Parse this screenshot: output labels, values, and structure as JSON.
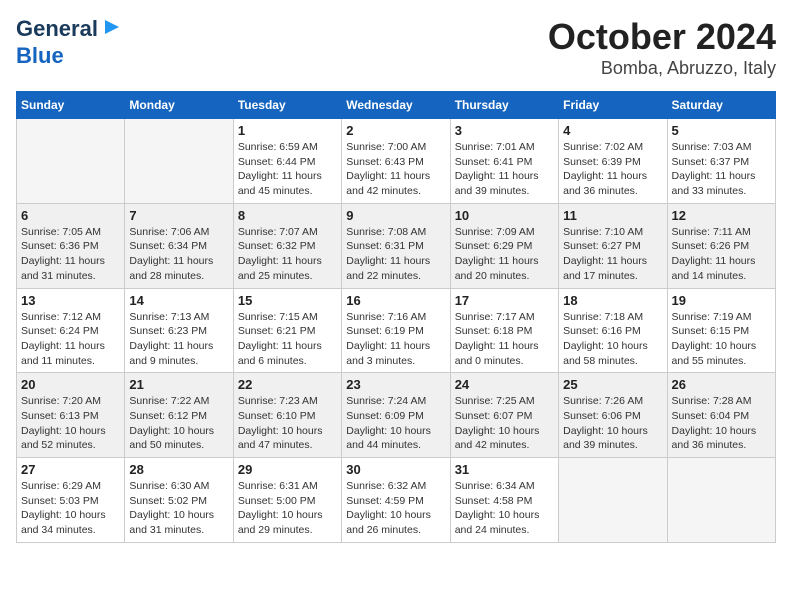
{
  "logo": {
    "line1": "General",
    "line2": "Blue"
  },
  "title": {
    "month": "October 2024",
    "location": "Bomba, Abruzzo, Italy"
  },
  "weekdays": [
    "Sunday",
    "Monday",
    "Tuesday",
    "Wednesday",
    "Thursday",
    "Friday",
    "Saturday"
  ],
  "weeks": [
    [
      {
        "day": "",
        "detail": ""
      },
      {
        "day": "",
        "detail": ""
      },
      {
        "day": "1",
        "detail": "Sunrise: 6:59 AM\nSunset: 6:44 PM\nDaylight: 11 hours and 45 minutes."
      },
      {
        "day": "2",
        "detail": "Sunrise: 7:00 AM\nSunset: 6:43 PM\nDaylight: 11 hours and 42 minutes."
      },
      {
        "day": "3",
        "detail": "Sunrise: 7:01 AM\nSunset: 6:41 PM\nDaylight: 11 hours and 39 minutes."
      },
      {
        "day": "4",
        "detail": "Sunrise: 7:02 AM\nSunset: 6:39 PM\nDaylight: 11 hours and 36 minutes."
      },
      {
        "day": "5",
        "detail": "Sunrise: 7:03 AM\nSunset: 6:37 PM\nDaylight: 11 hours and 33 minutes."
      }
    ],
    [
      {
        "day": "6",
        "detail": "Sunrise: 7:05 AM\nSunset: 6:36 PM\nDaylight: 11 hours and 31 minutes."
      },
      {
        "day": "7",
        "detail": "Sunrise: 7:06 AM\nSunset: 6:34 PM\nDaylight: 11 hours and 28 minutes."
      },
      {
        "day": "8",
        "detail": "Sunrise: 7:07 AM\nSunset: 6:32 PM\nDaylight: 11 hours and 25 minutes."
      },
      {
        "day": "9",
        "detail": "Sunrise: 7:08 AM\nSunset: 6:31 PM\nDaylight: 11 hours and 22 minutes."
      },
      {
        "day": "10",
        "detail": "Sunrise: 7:09 AM\nSunset: 6:29 PM\nDaylight: 11 hours and 20 minutes."
      },
      {
        "day": "11",
        "detail": "Sunrise: 7:10 AM\nSunset: 6:27 PM\nDaylight: 11 hours and 17 minutes."
      },
      {
        "day": "12",
        "detail": "Sunrise: 7:11 AM\nSunset: 6:26 PM\nDaylight: 11 hours and 14 minutes."
      }
    ],
    [
      {
        "day": "13",
        "detail": "Sunrise: 7:12 AM\nSunset: 6:24 PM\nDaylight: 11 hours and 11 minutes."
      },
      {
        "day": "14",
        "detail": "Sunrise: 7:13 AM\nSunset: 6:23 PM\nDaylight: 11 hours and 9 minutes."
      },
      {
        "day": "15",
        "detail": "Sunrise: 7:15 AM\nSunset: 6:21 PM\nDaylight: 11 hours and 6 minutes."
      },
      {
        "day": "16",
        "detail": "Sunrise: 7:16 AM\nSunset: 6:19 PM\nDaylight: 11 hours and 3 minutes."
      },
      {
        "day": "17",
        "detail": "Sunrise: 7:17 AM\nSunset: 6:18 PM\nDaylight: 11 hours and 0 minutes."
      },
      {
        "day": "18",
        "detail": "Sunrise: 7:18 AM\nSunset: 6:16 PM\nDaylight: 10 hours and 58 minutes."
      },
      {
        "day": "19",
        "detail": "Sunrise: 7:19 AM\nSunset: 6:15 PM\nDaylight: 10 hours and 55 minutes."
      }
    ],
    [
      {
        "day": "20",
        "detail": "Sunrise: 7:20 AM\nSunset: 6:13 PM\nDaylight: 10 hours and 52 minutes."
      },
      {
        "day": "21",
        "detail": "Sunrise: 7:22 AM\nSunset: 6:12 PM\nDaylight: 10 hours and 50 minutes."
      },
      {
        "day": "22",
        "detail": "Sunrise: 7:23 AM\nSunset: 6:10 PM\nDaylight: 10 hours and 47 minutes."
      },
      {
        "day": "23",
        "detail": "Sunrise: 7:24 AM\nSunset: 6:09 PM\nDaylight: 10 hours and 44 minutes."
      },
      {
        "day": "24",
        "detail": "Sunrise: 7:25 AM\nSunset: 6:07 PM\nDaylight: 10 hours and 42 minutes."
      },
      {
        "day": "25",
        "detail": "Sunrise: 7:26 AM\nSunset: 6:06 PM\nDaylight: 10 hours and 39 minutes."
      },
      {
        "day": "26",
        "detail": "Sunrise: 7:28 AM\nSunset: 6:04 PM\nDaylight: 10 hours and 36 minutes."
      }
    ],
    [
      {
        "day": "27",
        "detail": "Sunrise: 6:29 AM\nSunset: 5:03 PM\nDaylight: 10 hours and 34 minutes."
      },
      {
        "day": "28",
        "detail": "Sunrise: 6:30 AM\nSunset: 5:02 PM\nDaylight: 10 hours and 31 minutes."
      },
      {
        "day": "29",
        "detail": "Sunrise: 6:31 AM\nSunset: 5:00 PM\nDaylight: 10 hours and 29 minutes."
      },
      {
        "day": "30",
        "detail": "Sunrise: 6:32 AM\nSunset: 4:59 PM\nDaylight: 10 hours and 26 minutes."
      },
      {
        "day": "31",
        "detail": "Sunrise: 6:34 AM\nSunset: 4:58 PM\nDaylight: 10 hours and 24 minutes."
      },
      {
        "day": "",
        "detail": ""
      },
      {
        "day": "",
        "detail": ""
      }
    ]
  ]
}
